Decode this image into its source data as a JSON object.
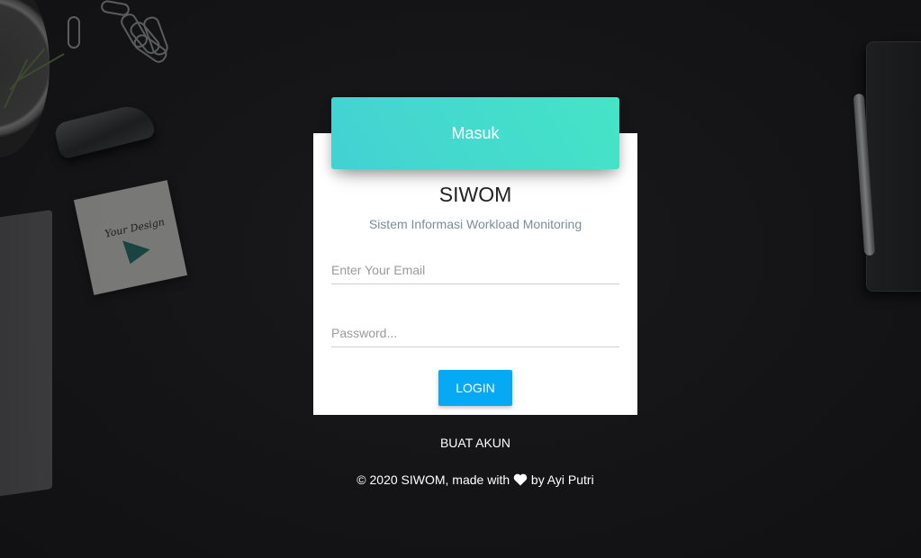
{
  "header": {
    "label": "Masuk"
  },
  "app": {
    "title": "SIWOM",
    "subtitle": "Sistem Informasi Workload Monitoring"
  },
  "form": {
    "email_placeholder": "Enter Your Email",
    "password_placeholder": "Password...",
    "login_label": "LOGIN"
  },
  "signup": {
    "label": "BUAT AKUN"
  },
  "footer": {
    "prefix": "© 2020 SIWOM, made with",
    "suffix": "by Ayi Putri",
    "icon": "heart-icon"
  },
  "background": {
    "note_text": "Your Design"
  },
  "colors": {
    "header_gradient_start": "#43d1d3",
    "header_gradient_end": "#45e4c6",
    "login_button": "#05a9f4",
    "background": "#151517"
  }
}
